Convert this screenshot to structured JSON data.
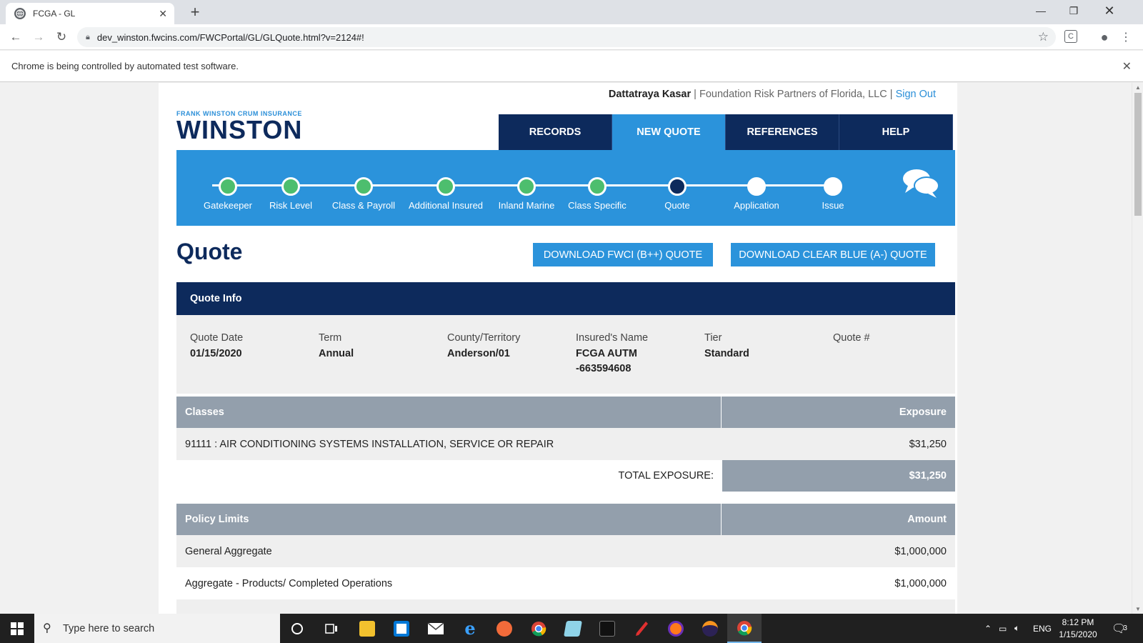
{
  "browser": {
    "tab_title": "FCGA - GL",
    "url": "dev_winston.fwcins.com/FWCPortal/GL/GLQuote.html?v=2124#!",
    "infobar_text": "Chrome is being controlled by automated test software."
  },
  "header": {
    "user_name": "Dattatraya Kasar",
    "separator": "|",
    "organization": "Foundation Risk Partners of Florida, LLC",
    "sign_out": "Sign Out",
    "logo_super": "FRANK WINSTON CRUM INSURANCE",
    "logo_main": "WINSTON"
  },
  "nav": {
    "items": [
      {
        "label": "RECORDS",
        "active": false
      },
      {
        "label": "NEW QUOTE",
        "active": true
      },
      {
        "label": "REFERENCES",
        "active": false
      },
      {
        "label": "HELP",
        "active": false
      }
    ]
  },
  "progress": {
    "steps": [
      {
        "label": "Gatekeeper",
        "state": "done"
      },
      {
        "label": "Risk Level",
        "state": "done"
      },
      {
        "label": "Class & Payroll",
        "state": "done"
      },
      {
        "label": "Additional Insured",
        "state": "done"
      },
      {
        "label": "Inland Marine",
        "state": "done"
      },
      {
        "label": "Class Specific",
        "state": "done"
      },
      {
        "label": "Quote",
        "state": "current"
      },
      {
        "label": "Application",
        "state": "todo"
      },
      {
        "label": "Issue",
        "state": "todo"
      }
    ]
  },
  "page": {
    "title": "Quote",
    "download_fwci": "DOWNLOAD FWCI (B++) QUOTE",
    "download_clear_blue": "DOWNLOAD CLEAR BLUE (A-) QUOTE"
  },
  "quote_info": {
    "header": "Quote Info",
    "fields": [
      {
        "label": "Quote Date",
        "value": "01/15/2020"
      },
      {
        "label": "Term",
        "value": "Annual"
      },
      {
        "label": "County/Territory",
        "value": "Anderson/01"
      },
      {
        "label": "Insured's Name",
        "value": "FCGA AUTM\n-663594608"
      },
      {
        "label": "Tier",
        "value": "Standard"
      },
      {
        "label": "Quote #",
        "value": ""
      }
    ]
  },
  "classes": {
    "col1": "Classes",
    "col2": "Exposure",
    "rows": [
      {
        "name": "91111 : AIR CONDITIONING SYSTEMS INSTALLATION, SERVICE OR REPAIR",
        "exposure": "$31,250"
      }
    ],
    "total_label": "TOTAL EXPOSURE:",
    "total_value": "$31,250"
  },
  "policy_limits": {
    "col1": "Policy Limits",
    "col2": "Amount",
    "rows": [
      {
        "name": "General Aggregate",
        "amount": "$1,000,000"
      },
      {
        "name": "Aggregate - Products/ Completed Operations",
        "amount": "$1,000,000"
      }
    ]
  },
  "taskbar": {
    "search_placeholder": "Type here to search",
    "language": "ENG",
    "time": "8:12 PM",
    "date": "1/15/2020",
    "notification_count": "3"
  },
  "colors": {
    "navy": "#0d2a5c",
    "accent_blue": "#2b93db",
    "step_done": "#4dbe6e",
    "grid_header": "#939fac"
  }
}
